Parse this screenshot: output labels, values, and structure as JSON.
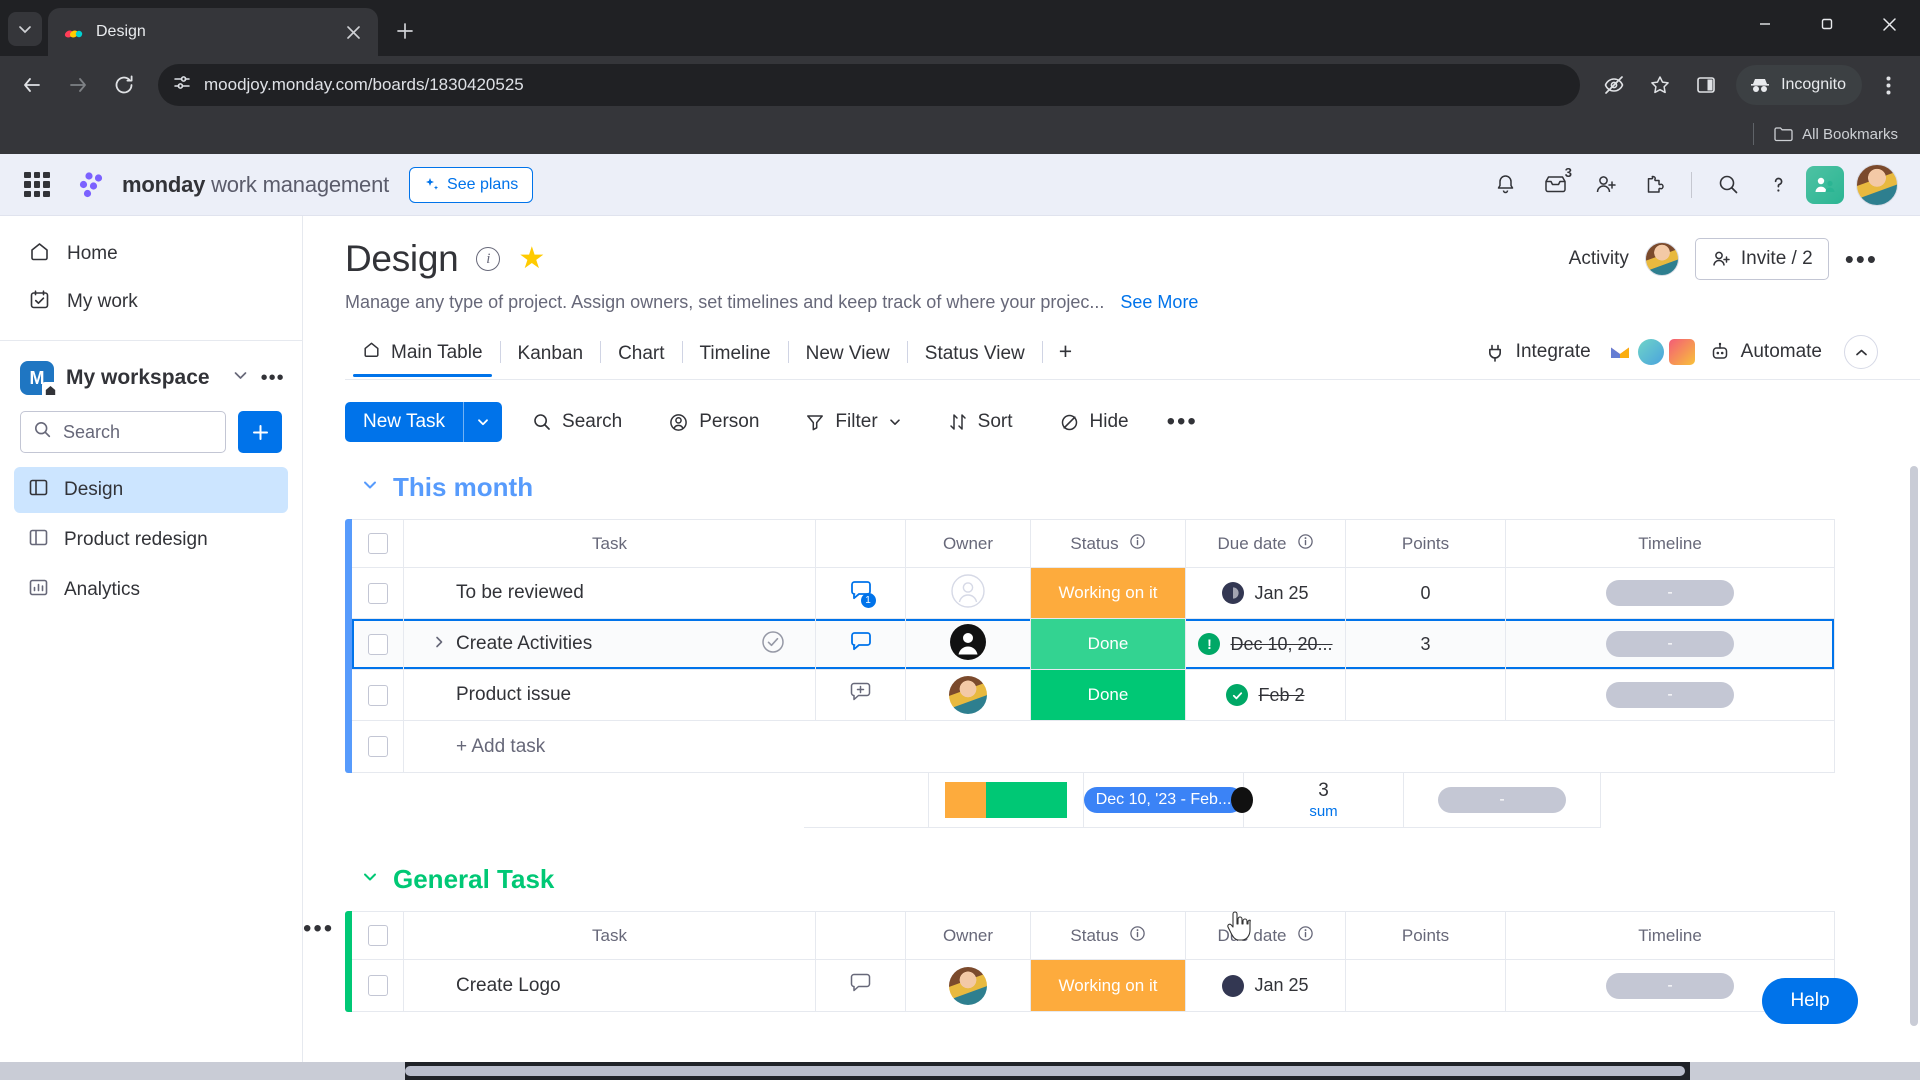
{
  "browser": {
    "tab": {
      "title": "Design",
      "favicon": "monday-favicon"
    },
    "new_tab_label": "+",
    "url": "moodjoy.monday.com/boards/1830420525",
    "incognito_label": "Incognito",
    "bookmarks_label": "All Bookmarks",
    "window": {
      "minimize": "—",
      "maximize": "□",
      "close": "✕"
    }
  },
  "topbar": {
    "brand_bold": "monday",
    "brand_rest": " work management",
    "see_plans": "See plans",
    "inbox_badge": "3"
  },
  "sidebar": {
    "nav": [
      {
        "label": "Home",
        "icon": "home-icon"
      },
      {
        "label": "My work",
        "icon": "calendar-check-icon"
      }
    ],
    "workspace": {
      "initial": "M",
      "name": "My workspace"
    },
    "search_placeholder": "Search",
    "add_label": "+",
    "boards": [
      {
        "label": "Design",
        "icon": "board-icon",
        "active": true
      },
      {
        "label": "Product redesign",
        "icon": "board-icon",
        "active": false
      },
      {
        "label": "Analytics",
        "icon": "dashboard-icon",
        "active": false
      }
    ]
  },
  "board": {
    "title": "Design",
    "description": "Manage any type of project. Assign owners, set timelines and keep track of where your projec...",
    "see_more": "See More",
    "activity_label": "Activity",
    "invite_label": "Invite / 2",
    "tabs": [
      {
        "label": "Main Table",
        "active": true,
        "icon": "home-icon"
      },
      {
        "label": "Kanban",
        "active": false
      },
      {
        "label": "Chart",
        "active": false
      },
      {
        "label": "Timeline",
        "active": false
      },
      {
        "label": "New View",
        "active": false
      },
      {
        "label": "Status View",
        "active": false
      }
    ],
    "add_tab": "+",
    "integrate_label": "Integrate",
    "automate_label": "Automate"
  },
  "toolbar": {
    "new_task": "New Task",
    "items": [
      {
        "label": "Search",
        "icon": "search-icon"
      },
      {
        "label": "Person",
        "icon": "person-icon"
      },
      {
        "label": "Filter",
        "icon": "filter-icon",
        "chevron": true
      },
      {
        "label": "Sort",
        "icon": "sort-icon"
      },
      {
        "label": "Hide",
        "icon": "hide-icon"
      }
    ],
    "more": "•••"
  },
  "table": {
    "columns": [
      "Task",
      "Owner",
      "Status",
      "Due date",
      "Points",
      "Timeline"
    ],
    "add_task_label": "+ Add task",
    "groups": [
      {
        "name": "This month",
        "color": "#579bfc",
        "rows": [
          {
            "task": "To be reviewed",
            "chat": "comment-badge-icon",
            "chat_count": "1",
            "owner": "empty",
            "status": "Working on it",
            "status_color": "#fdab3d",
            "due": "Jan 25",
            "due_strike": false,
            "due_dot": "dark",
            "points": "0",
            "timeline": "-"
          },
          {
            "task": "Create Activities",
            "chat": "comment-icon",
            "owner": "avatar-dark",
            "status": "Done",
            "status_color": "#33d391",
            "due": "Dec 10, 20...",
            "due_strike": true,
            "due_dot": "green-alert",
            "points": "3",
            "timeline": "-",
            "expandable": true,
            "selected": true
          },
          {
            "task": "Product issue",
            "chat": "comment-add-icon",
            "owner": "avatar-user",
            "status": "Done",
            "status_color": "#00c875",
            "due": "Feb 2",
            "due_strike": true,
            "due_dot": "green-check",
            "points": "",
            "timeline": "-"
          }
        ],
        "summary": {
          "status_split": [
            33,
            67
          ],
          "due_range": "Dec 10, '23 - Feb...",
          "points": "3",
          "points_label": "sum",
          "timeline": "-"
        }
      },
      {
        "name": "General Task",
        "color": "#00c875",
        "rows": [
          {
            "task": "Create Logo",
            "chat": "comment-icon",
            "owner": "avatar-user",
            "status": "Working on it",
            "status_color": "#fdab3d",
            "due": "Jan 25",
            "due_strike": false,
            "due_dot": "dark",
            "points": "",
            "timeline": "-"
          }
        ]
      }
    ]
  },
  "help": {
    "label": "Help"
  }
}
